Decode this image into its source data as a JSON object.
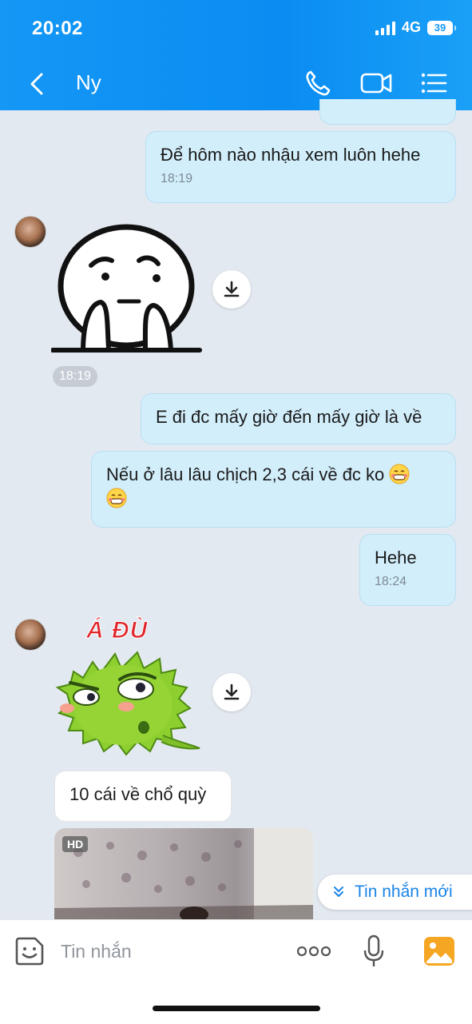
{
  "status_bar": {
    "time": "20:02",
    "network": "4G",
    "battery": "39"
  },
  "header": {
    "contact_name": "Ny"
  },
  "icons": {
    "back": "chevron-left-icon",
    "call": "phone-icon",
    "video": "video-camera-icon",
    "menu": "list-menu-icon",
    "download": "download-icon",
    "sticker": "sticker-smile-icon",
    "more": "more-dots-icon",
    "mic": "microphone-icon",
    "gallery": "image-gallery-icon",
    "new_message": "chevron-double-down-icon"
  },
  "messages": [
    {
      "direction": "out",
      "text": "Để hôm nào nhậu xem luôn hehe",
      "time": "18:19"
    },
    {
      "direction": "in",
      "type": "sticker",
      "caption": ""
    },
    {
      "direction": "out",
      "text": "E đi đc mấy giờ đến mấy giờ là về"
    },
    {
      "direction": "out",
      "text": "Nếu ở lâu lâu chịch 2,3 cái về đc ko"
    },
    {
      "direction": "out",
      "text": "Hehe",
      "time": "18:24"
    },
    {
      "direction": "in",
      "type": "sticker",
      "caption": "Á ĐÙ"
    },
    {
      "direction": "in",
      "text": "10 cái về chổ quỳ"
    },
    {
      "direction": "in",
      "type": "video",
      "badge": "HD"
    }
  ],
  "timestamps": {
    "sticker_time": "18:19"
  },
  "new_message_banner": "Tin nhắn mới",
  "composer": {
    "placeholder": "Tin nhắn",
    "more_label": "ooo"
  },
  "colors": {
    "header": "#0a8cf2",
    "outgoing_bubble": "#d2eefb",
    "incoming_bubble": "#ffffff",
    "background": "#e3e9f0",
    "accent": "#1a84e8",
    "gallery": "#f5a623"
  }
}
